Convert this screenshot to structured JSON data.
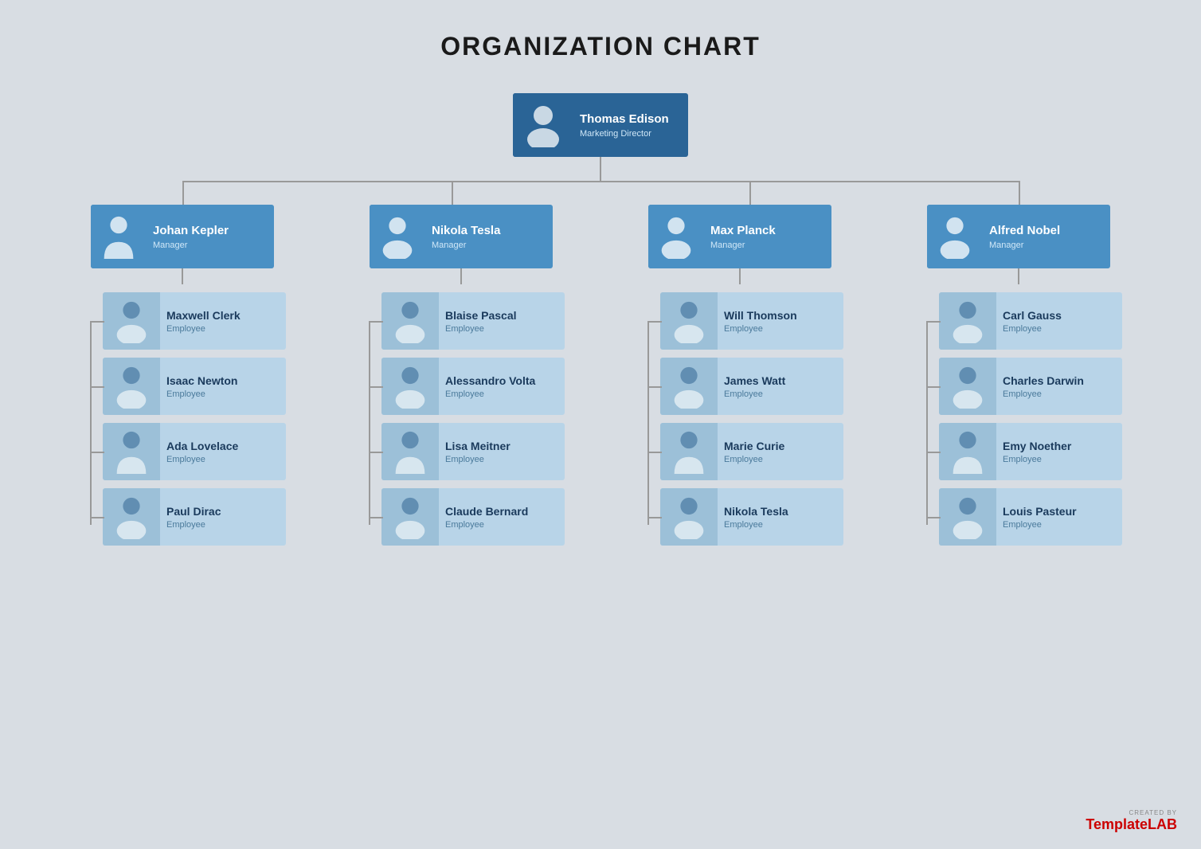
{
  "title": "ORGANIZATION CHART",
  "director": {
    "name": "Thomas Edison",
    "role": "Marketing Director",
    "gender": "male"
  },
  "managers": [
    {
      "name": "Johan Kepler",
      "role": "Manager",
      "gender": "female"
    },
    {
      "name": "Nikola Tesla",
      "role": "Manager",
      "gender": "male"
    },
    {
      "name": "Max Planck",
      "role": "Manager",
      "gender": "male"
    },
    {
      "name": "Alfred Nobel",
      "role": "Manager",
      "gender": "male"
    }
  ],
  "employees": [
    [
      {
        "name": "Maxwell Clerk",
        "role": "Employee",
        "gender": "male"
      },
      {
        "name": "Isaac Newton",
        "role": "Employee",
        "gender": "male"
      },
      {
        "name": "Ada Lovelace",
        "role": "Employee",
        "gender": "female"
      },
      {
        "name": "Paul Dirac",
        "role": "Employee",
        "gender": "male"
      }
    ],
    [
      {
        "name": "Blaise Pascal",
        "role": "Employee",
        "gender": "male"
      },
      {
        "name": "Alessandro Volta",
        "role": "Employee",
        "gender": "male"
      },
      {
        "name": "Lisa Meitner",
        "role": "Employee",
        "gender": "female"
      },
      {
        "name": "Claude Bernard",
        "role": "Employee",
        "gender": "male"
      }
    ],
    [
      {
        "name": "Will Thomson",
        "role": "Employee",
        "gender": "male"
      },
      {
        "name": "James Watt",
        "role": "Employee",
        "gender": "male"
      },
      {
        "name": "Marie Curie",
        "role": "Employee",
        "gender": "female"
      },
      {
        "name": "Nikola Tesla",
        "role": "Employee",
        "gender": "male"
      }
    ],
    [
      {
        "name": "Carl Gauss",
        "role": "Employee",
        "gender": "male"
      },
      {
        "name": "Charles Darwin",
        "role": "Employee",
        "gender": "male"
      },
      {
        "name": "Emy Noether",
        "role": "Employee",
        "gender": "female"
      },
      {
        "name": "Louis Pasteur",
        "role": "Employee",
        "gender": "male"
      }
    ]
  ],
  "watermark": {
    "created_by": "CREATED BY",
    "brand_normal": "Template",
    "brand_accent": "LAB"
  }
}
